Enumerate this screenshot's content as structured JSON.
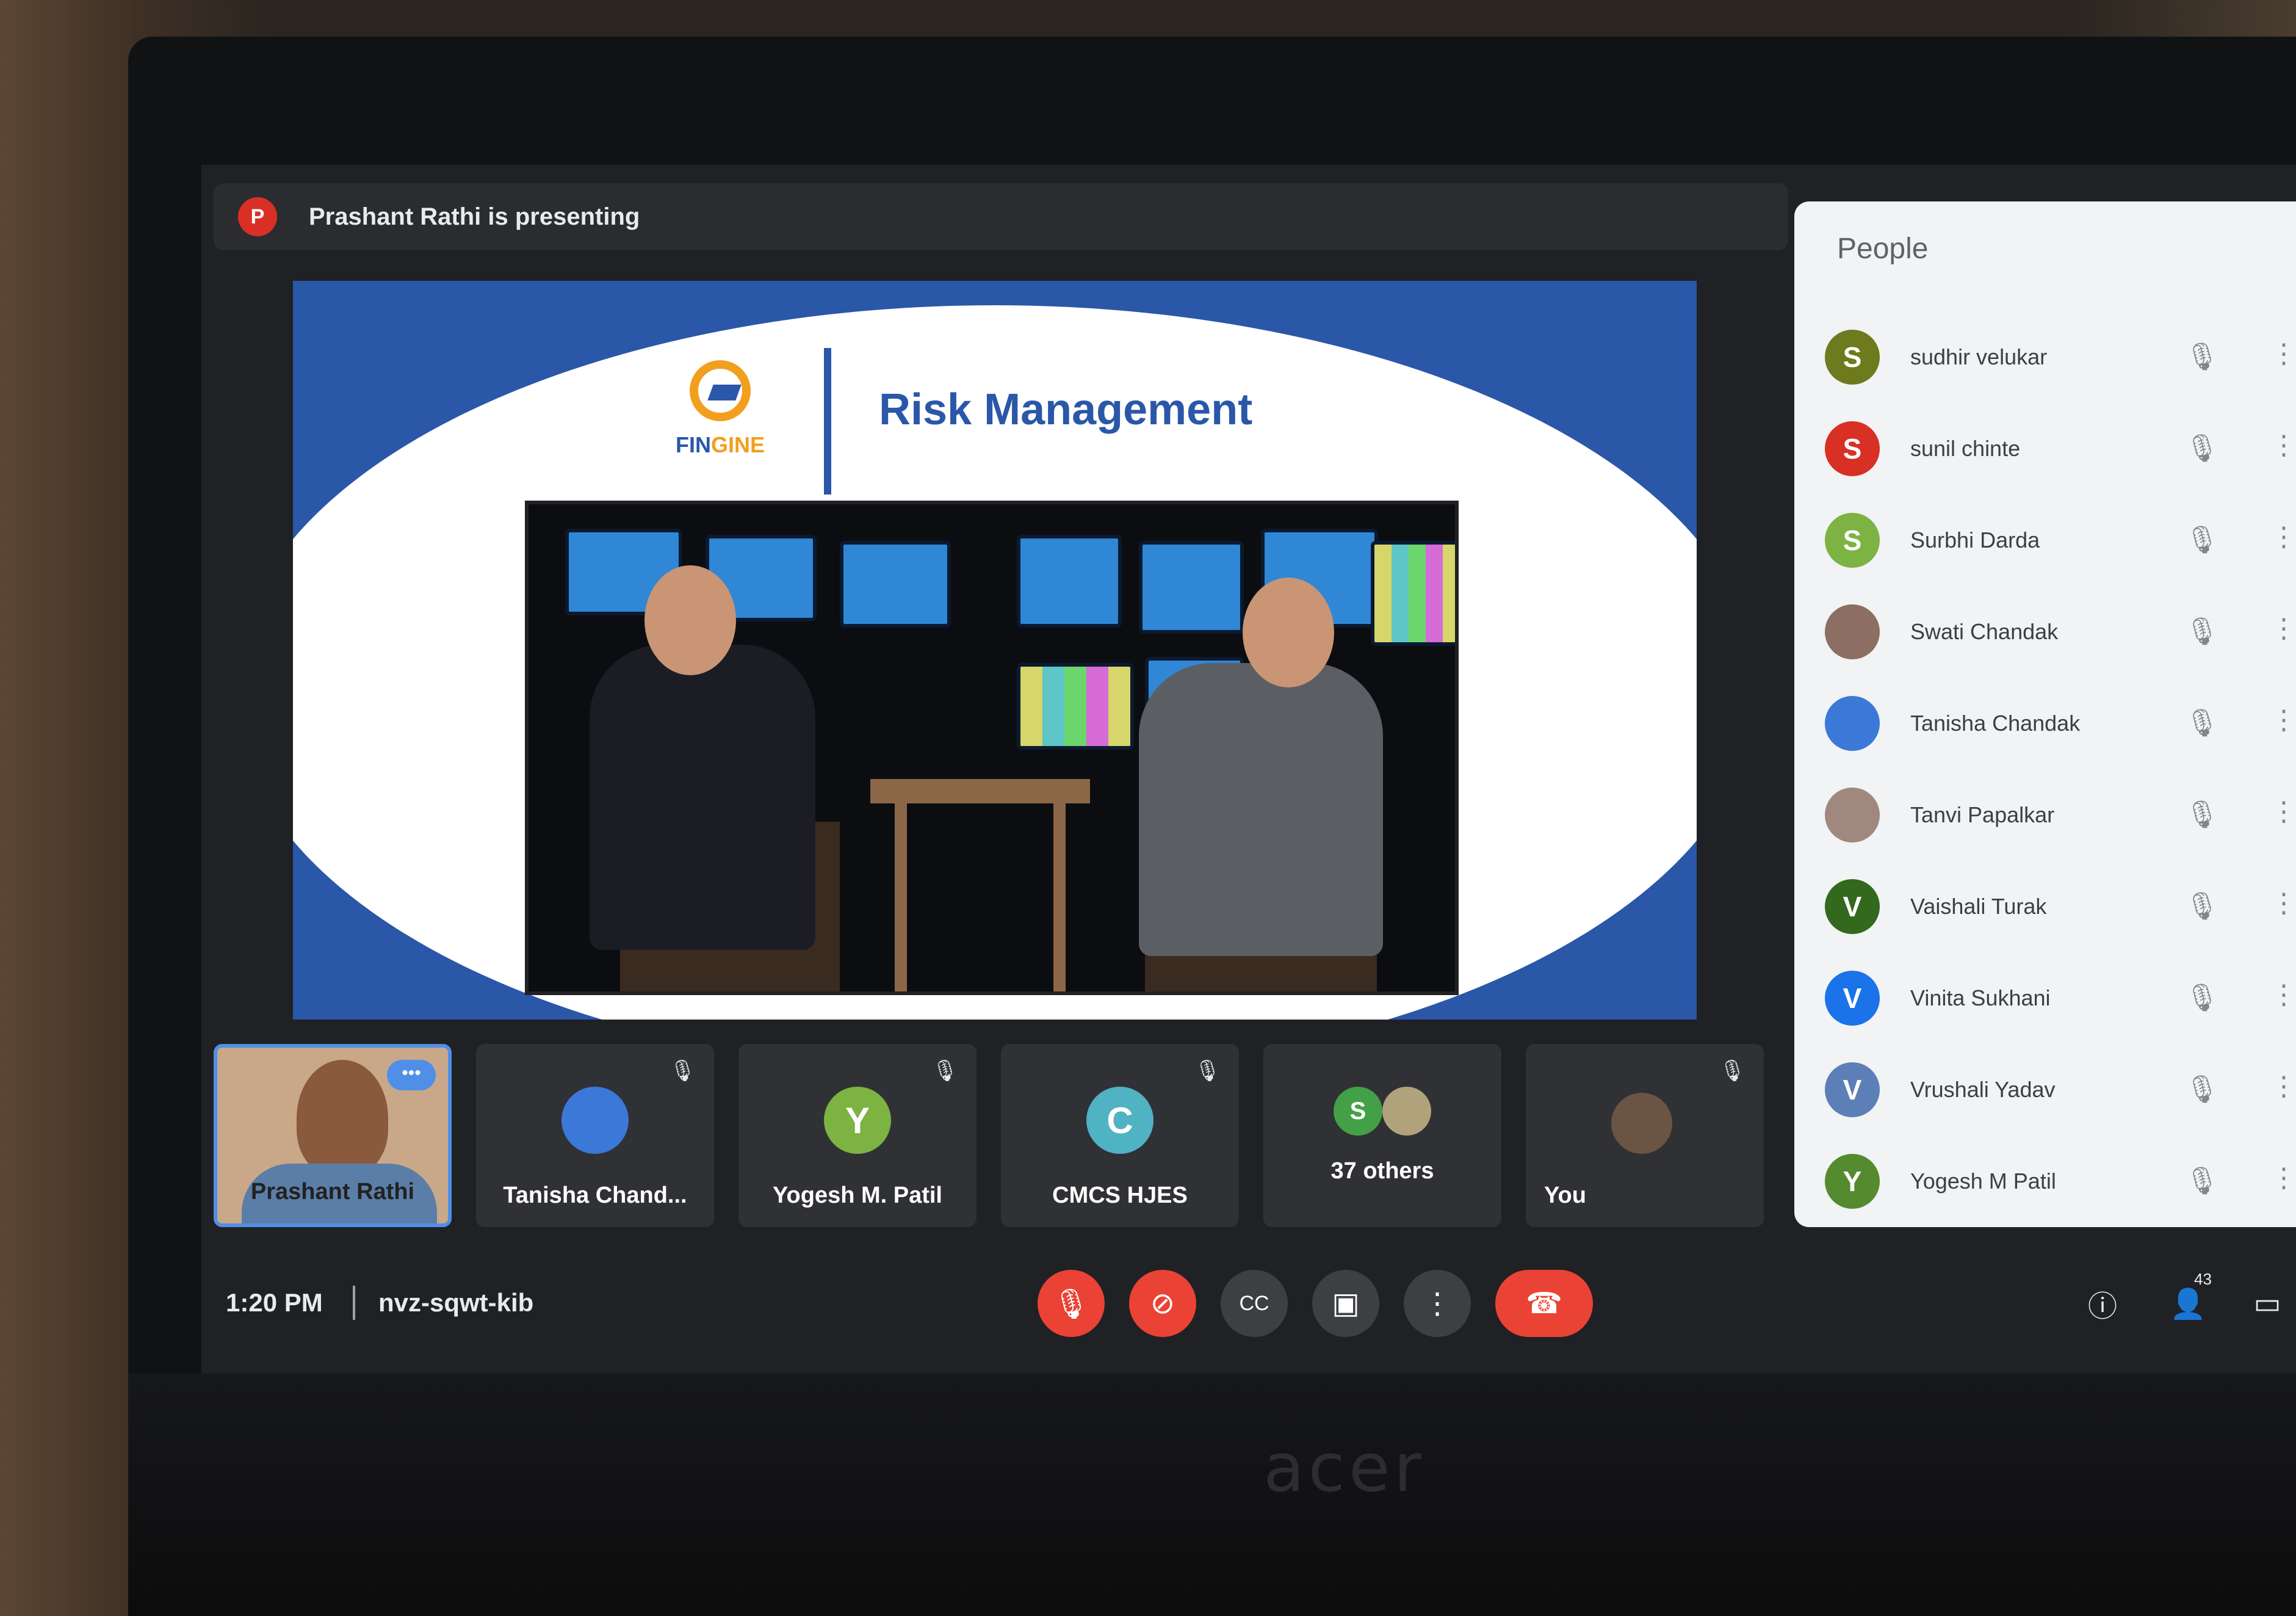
{
  "presenting": {
    "avatar_letter": "P",
    "text": "Prashant Rathi is presenting"
  },
  "slide": {
    "title": "Risk Management",
    "logo_text_a": "FIN",
    "logo_text_b": "GINE"
  },
  "tiles": [
    {
      "name": "Prashant Rathi",
      "letter": "",
      "color": "#c9a88a"
    },
    {
      "name": "Tanisha Chand...",
      "letter": "",
      "color": "#3b78d8"
    },
    {
      "name": "Yogesh M. Patil",
      "letter": "Y",
      "color": "#7cb342"
    },
    {
      "name": "CMCS HJES",
      "letter": "C",
      "color": "#4fb3c4"
    },
    {
      "name": "37 others",
      "letter": "S",
      "color": "#43a047"
    },
    {
      "name": "You",
      "letter": "",
      "color": "#303134"
    }
  ],
  "bottombar": {
    "time": "1:20 PM",
    "meeting_code": "nvz-sqwt-kib",
    "participant_count": "43"
  },
  "people_panel": {
    "title": "People",
    "members": [
      {
        "name": "sudhir velukar",
        "letter": "S",
        "color": "#6d7a1e"
      },
      {
        "name": "sunil chinte",
        "letter": "S",
        "color": "#d93025"
      },
      {
        "name": "Surbhi Darda",
        "letter": "S",
        "color": "#7cb342"
      },
      {
        "name": "Swati Chandak",
        "letter": "",
        "color": "#8d6e63"
      },
      {
        "name": "Tanisha Chandak",
        "letter": "",
        "color": "#3b78d8"
      },
      {
        "name": "Tanvi Papalkar",
        "letter": "",
        "color": "#a1887f"
      },
      {
        "name": "Vaishali Turak",
        "letter": "V",
        "color": "#33691e"
      },
      {
        "name": "Vinita Sukhani",
        "letter": "V",
        "color": "#1a73e8"
      },
      {
        "name": "Vrushali Yadav",
        "letter": "V",
        "color": "#5c7fb8"
      },
      {
        "name": "Yogesh M Patil",
        "letter": "Y",
        "color": "#558b2f"
      }
    ]
  }
}
